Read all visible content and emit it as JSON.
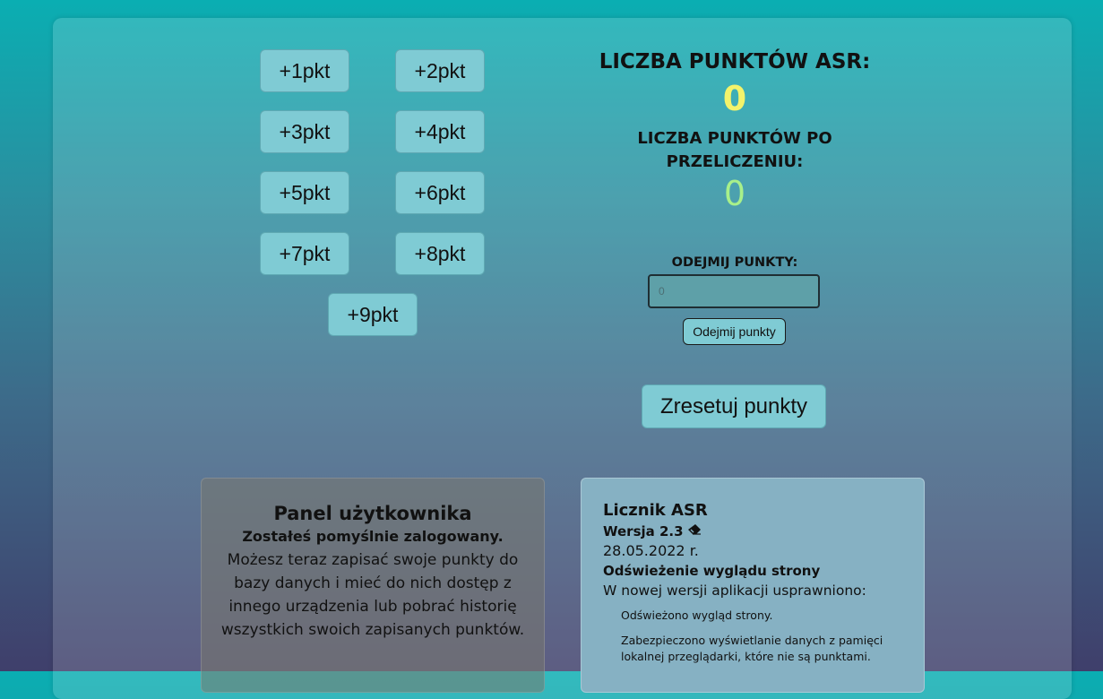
{
  "point_buttons": [
    "+1pkt",
    "+2pkt",
    "+3pkt",
    "+4pkt",
    "+5pkt",
    "+6pkt",
    "+7pkt",
    "+8pkt",
    "+9pkt"
  ],
  "scores": {
    "asr_label": "LICZBA PUNKTÓW ASR:",
    "asr_value": "0",
    "converted_label": "LICZBA PUNKTÓW PO PRZELICZENIU:",
    "converted_value": "0"
  },
  "subtract": {
    "label": "ODEJMIJ PUNKTY:",
    "placeholder": "0",
    "button": "Odejmij punkty"
  },
  "reset_button": "Zresetuj punkty",
  "user_panel": {
    "title": "Panel użytkownika",
    "subtitle": "Zostałeś pomyślnie zalogowany.",
    "description": "Możesz teraz zapisać swoje punkty do bazy danych i mieć do nich dostęp z innego urządzenia lub pobrać historię wszystkich swoich zapisanych punktów."
  },
  "info_panel": {
    "name": "Licznik ASR",
    "version": "Wersja 2.3",
    "version_icon": "eraser-icon",
    "date": "28.05.2022 r.",
    "update_title": "Odświeżenie wyglądu strony",
    "intro": "W nowej wersji aplikacji usprawniono:",
    "changes": [
      "Odświeżono wygląd strony.",
      "Zabezpieczono wyświetlanie danych z pamięci lokalnej przeglądarki, które nie są punktami."
    ]
  },
  "colors": {
    "asr_value": "#f3f36b",
    "converted_value": "#a8f08a",
    "button_bg": "#7fcbd4"
  }
}
